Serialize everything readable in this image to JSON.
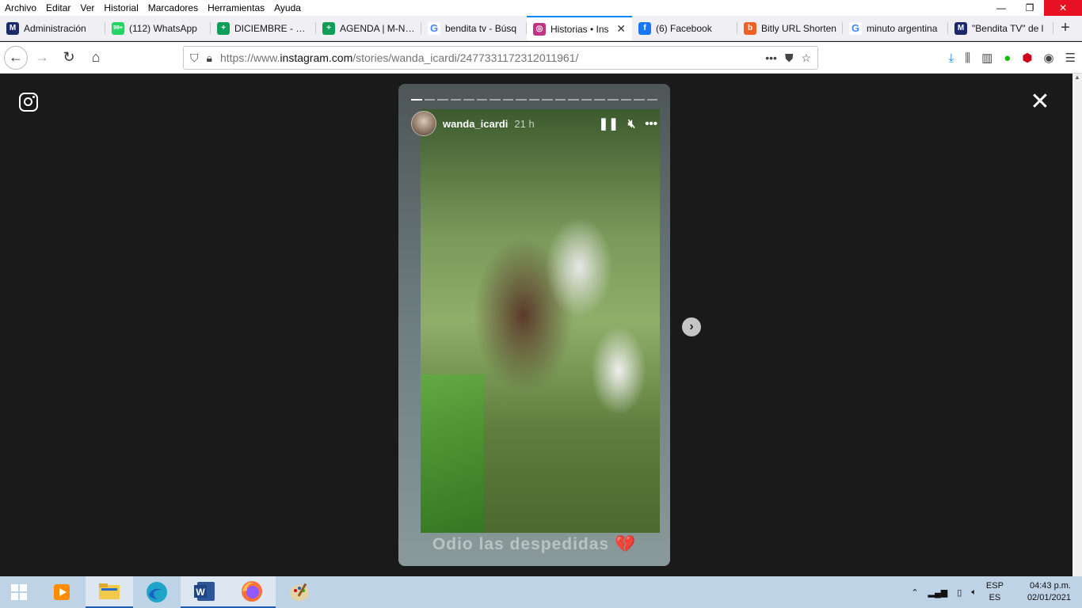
{
  "menu": [
    "Archivo",
    "Editar",
    "Ver",
    "Historial",
    "Marcadores",
    "Herramientas",
    "Ayuda"
  ],
  "window_controls": {
    "minimize": "—",
    "restore": "❐",
    "close": "✕"
  },
  "tabs": [
    {
      "label": "Administración",
      "icon": "m-icon",
      "color": "#1b2a6b",
      "glyph": "M"
    },
    {
      "label": "(112) WhatsApp",
      "icon": "whatsapp-icon",
      "color": "#25d366",
      "glyph": "99+"
    },
    {
      "label": "DICIEMBRE - MIN",
      "icon": "sheets-icon",
      "color": "#0f9d58",
      "glyph": "+"
    },
    {
      "label": "AGENDA | M-NEU",
      "icon": "sheets-icon",
      "color": "#0f9d58",
      "glyph": "+"
    },
    {
      "label": "bendita tv - Búsq",
      "icon": "google-icon",
      "color": "#ffffff",
      "glyph": "G"
    },
    {
      "label": "Historias • Ins",
      "icon": "instagram-icon",
      "color": "#c13584",
      "glyph": "◎",
      "active": true
    },
    {
      "label": "(6) Facebook",
      "icon": "facebook-icon",
      "color": "#1877f2",
      "glyph": "f"
    },
    {
      "label": "Bitly URL Shorten",
      "icon": "bitly-icon",
      "color": "#ee6123",
      "glyph": "b"
    },
    {
      "label": "minuto argentina",
      "icon": "google-icon",
      "color": "#ffffff",
      "glyph": "G"
    },
    {
      "label": "\"Bendita TV\" de l",
      "icon": "m-icon",
      "color": "#1b2a6b",
      "glyph": "M"
    }
  ],
  "newtab": "+",
  "nav": {
    "url_prefix": "https://www.",
    "url_domain": "instagram.com",
    "url_path": "/stories/wanda_icardi/2477331172312011961/"
  },
  "story": {
    "username": "wanda_icardi",
    "time": "21 h",
    "caption": "Odio las despedidas",
    "caption_emoji": "💔",
    "segments_total": 19,
    "segments_done": 1
  },
  "taskbar": {
    "apps": [
      "vlc-icon",
      "file-explorer-icon",
      "edge-icon",
      "word-icon",
      "firefox-icon",
      "paint-icon"
    ],
    "lang_top": "ESP",
    "lang_bottom": "ES",
    "time": "04:43 p.m.",
    "date": "02/01/2021"
  }
}
